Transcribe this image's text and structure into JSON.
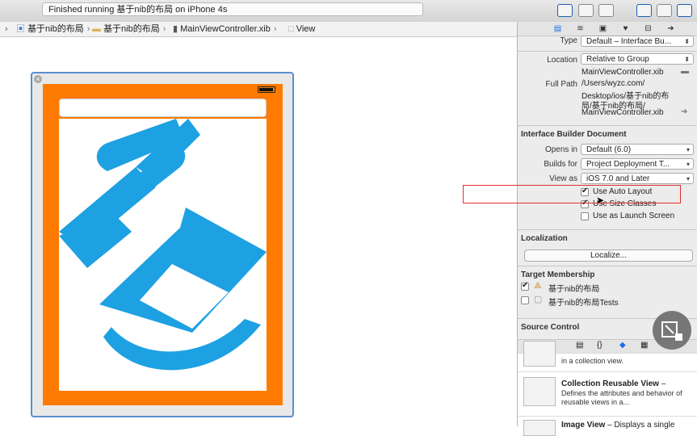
{
  "toolbar": {
    "status_text": "Finished running 基于nib的布局 on iPhone 4s"
  },
  "jumpbar": {
    "crumbs": [
      "基于nib的布局",
      "基于nib的布局",
      "MainViewController.xib",
      "View"
    ]
  },
  "canvas": {
    "close_glyph": "×"
  },
  "inspector": {
    "tab_icons": [
      "file-icon",
      "history-icon",
      "help-icon",
      "identity-icon",
      "attributes-icon",
      "connections-icon"
    ],
    "type_label": "Type",
    "type_value": "Default – Interface Bu...",
    "location_label": "Location",
    "location_value": "Relative to Group",
    "filename": "MainViewController.xib",
    "full_path_label": "Full Path",
    "full_path_lines": [
      "/Users/wyzc.com/",
      "Desktop/ios/基于nib的布",
      "局/基于nib的布局/",
      "MainViewController.xib"
    ],
    "ib_doc_header": "Interface Builder Document",
    "opens_in_label": "Opens in",
    "opens_in_value": "Default (6.0)",
    "builds_for_label": "Builds for",
    "builds_for_value": "Project Deployment T...",
    "view_as_label": "View as",
    "view_as_value": "iOS 7.0 and Later",
    "use_auto_layout": "Use Auto Layout",
    "use_size_classes": "Use Size Classes",
    "use_launch_screen": "Use as Launch Screen",
    "localization_header": "Localization",
    "localize_button": "Localize...",
    "target_header": "Target Membership",
    "target_1": "基于nib的布局",
    "target_2": "基于nib的布局Tests",
    "source_control_header": "Source Control",
    "library_tabs": [
      "file-template-icon",
      "{}",
      "object-icon",
      "media-icon"
    ],
    "lib_partial_text": "in a collection view.",
    "lib_item_title": "Collection Reusable View",
    "lib_item_dash": " –",
    "lib_item_desc": "Defines the attributes and behavior of reusable views in a...",
    "lib_item2_title": "Image View",
    "lib_item2_desc": " – Displays a single"
  }
}
